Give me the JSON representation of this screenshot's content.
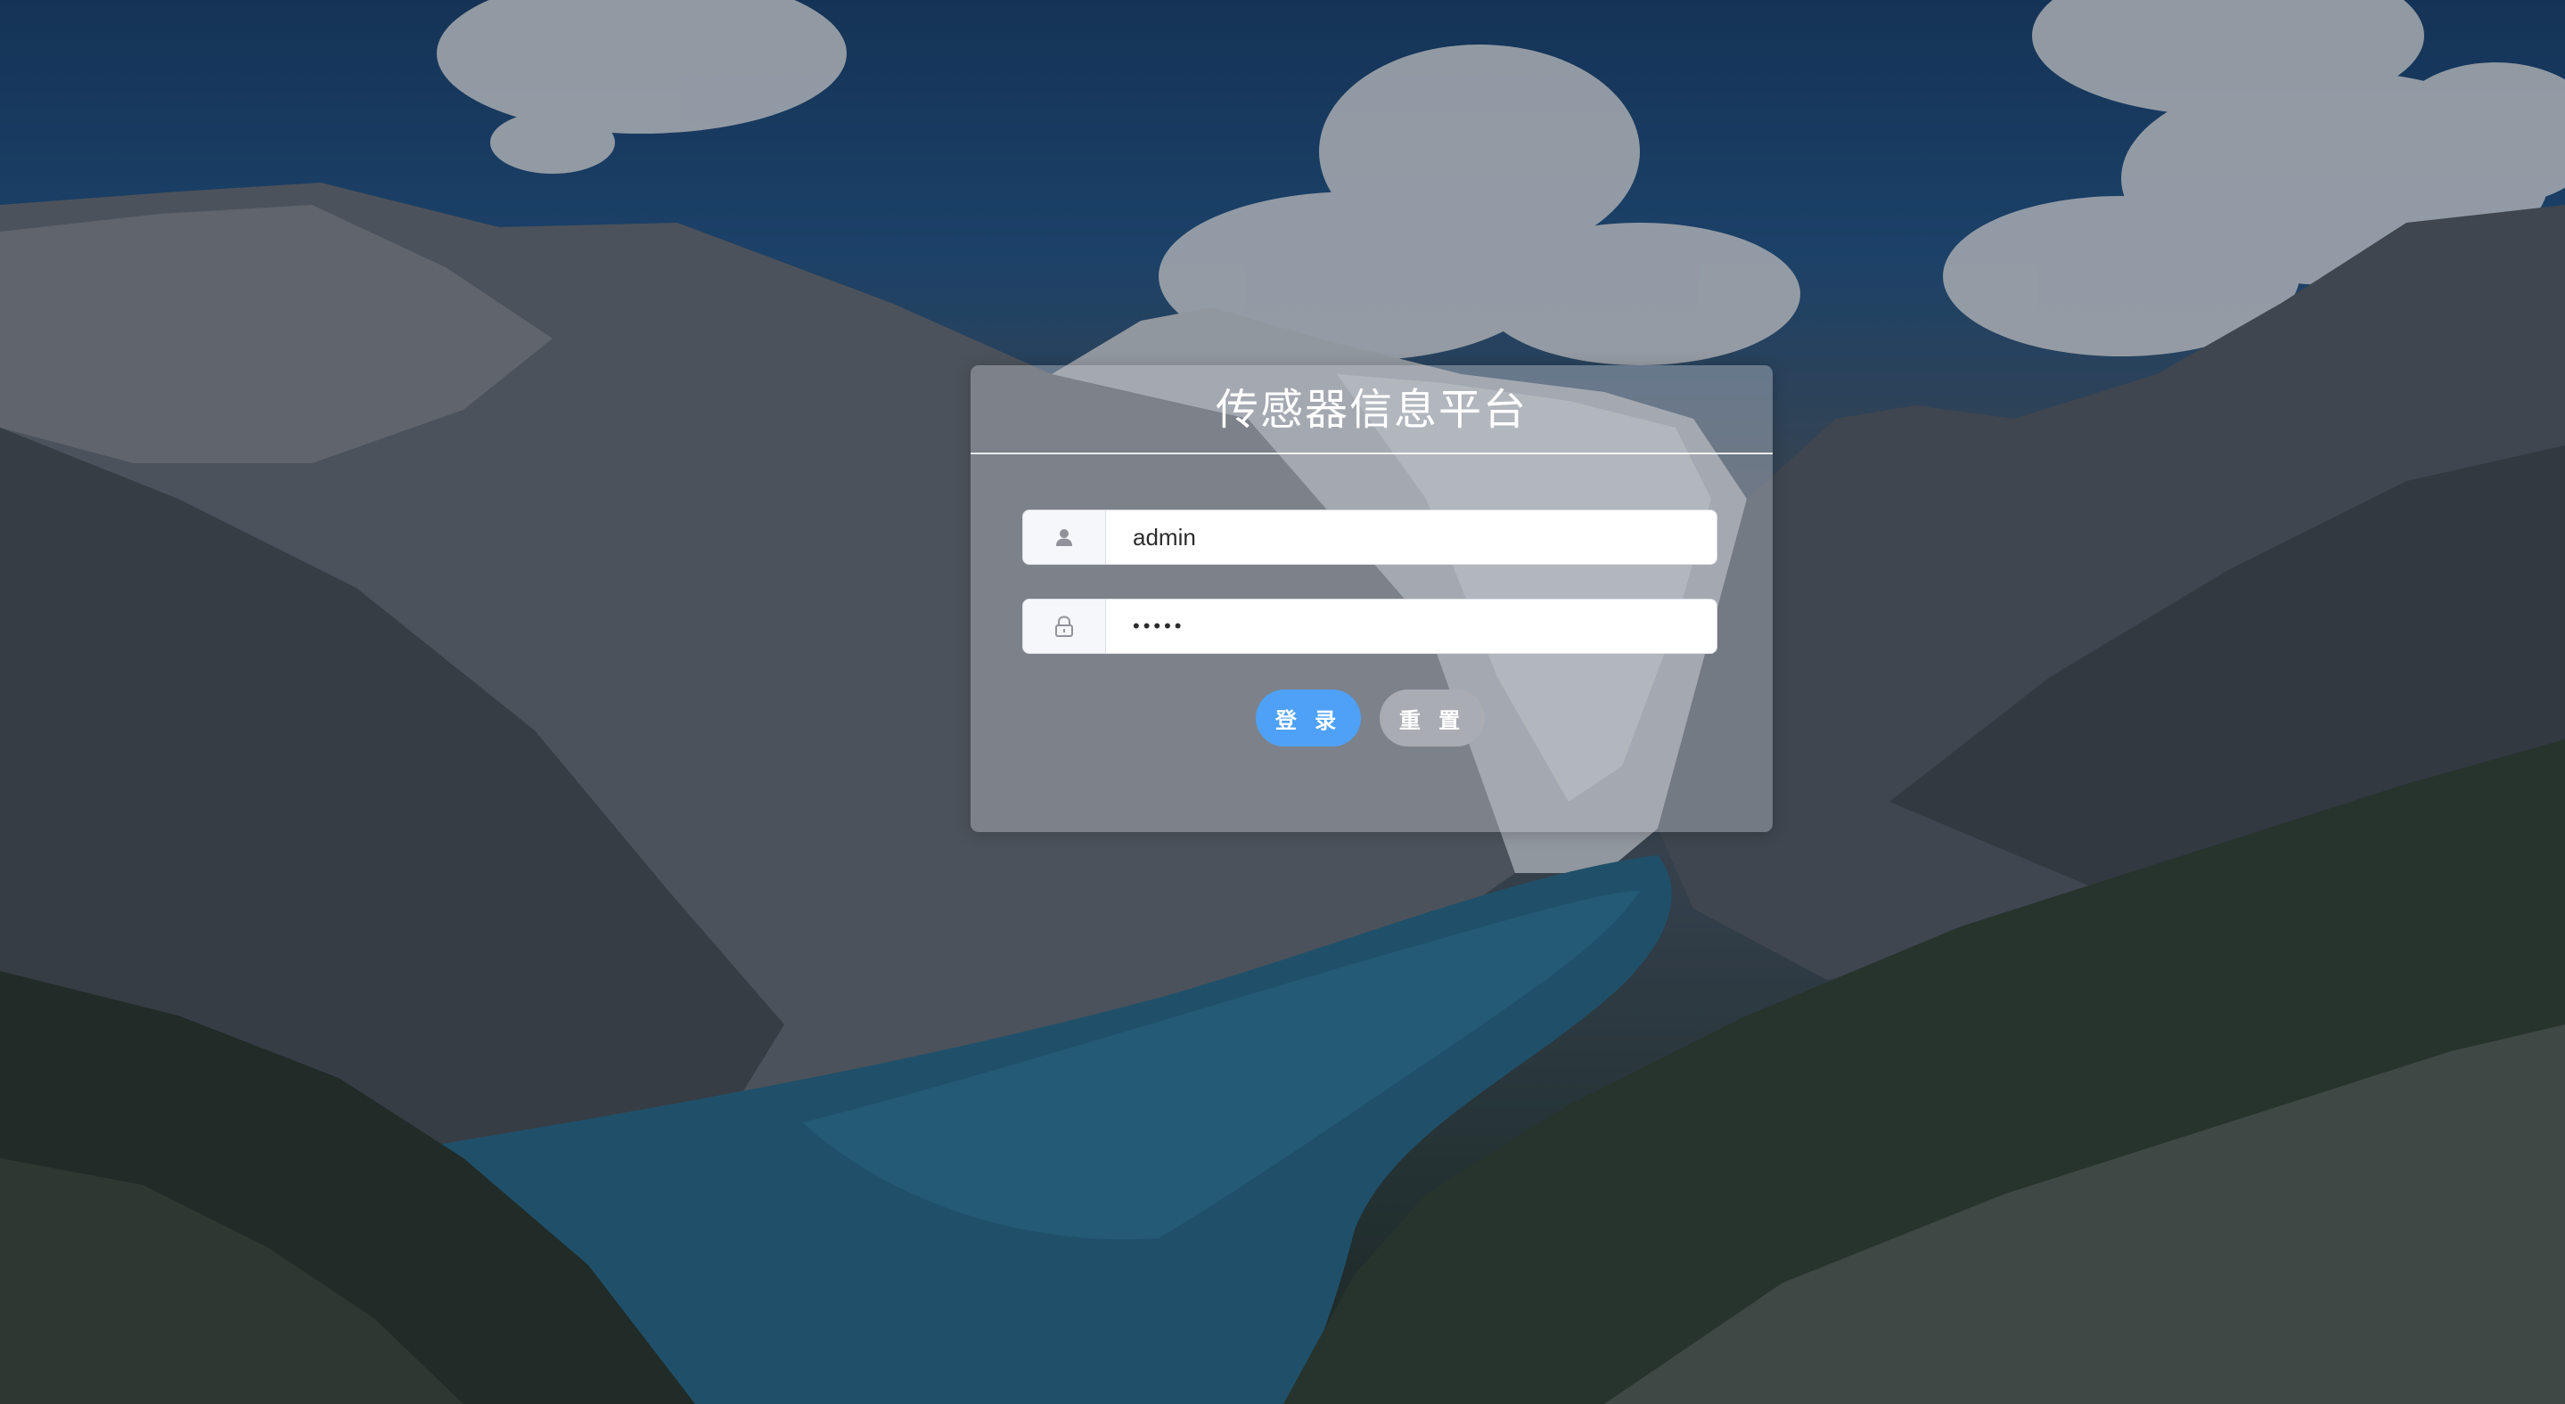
{
  "app": {
    "title": "传感器信息平台"
  },
  "form": {
    "username": {
      "value": "admin",
      "icon": "user-icon"
    },
    "password": {
      "value": "•••••",
      "icon": "lock-icon"
    }
  },
  "buttons": {
    "login_label": "登 录",
    "reset_label": "重 置"
  },
  "colors": {
    "login_button": "#4ea1f7",
    "reset_button": "#a9acb2",
    "card_background": "rgba(190,196,204,0.42)"
  }
}
